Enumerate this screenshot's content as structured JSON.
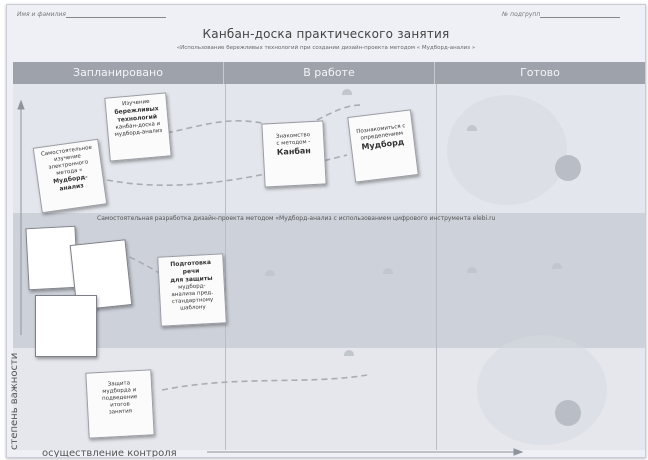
{
  "fields": {
    "name_label": "Имя и фамилия",
    "subgroup_label": "№ подгрупп"
  },
  "title": "Канбан-доска практического занятия",
  "subtitle": "«Использование бережливых технологий при создании дизайн-проекта методом « Мудборд-анализ »",
  "columns": [
    "Запланировано",
    "В работе",
    "Готово"
  ],
  "middle_band_text": "Самостоятельная разработка дизайн-проекта методом «Мудборд-анализ с использованием цифрового инструмента elebi.ru",
  "cards": {
    "study": {
      "l1": "Изучение",
      "l2": "бережливых",
      "l3": "технологий",
      "l4": "канбан-доска и",
      "l5": "мудборд-анализ"
    },
    "self": {
      "l1": "Самостоятельное",
      "l2": "изучение",
      "l3": "электронного",
      "l4": "метода «",
      "l5": "Мудборд-анализ"
    },
    "kanban": {
      "l1": "Знакомство",
      "l2": "с методом -",
      "l3": "Канбан"
    },
    "moodboard": {
      "l1": "Познакомиться с",
      "l2": "определением",
      "l3": "Мудборд"
    },
    "speech": {
      "l1": "Подготовка речи",
      "l2": "для защиты",
      "l3": "мудборд-",
      "l4": "анализа пред.",
      "l5": "стандартному",
      "l6": "шаблону"
    },
    "defense": {
      "l1": "Защита",
      "l2": "мудборда и",
      "l3": "подведение",
      "l4": "итогов",
      "l5": "занятия"
    }
  },
  "axes": {
    "y": "степень важности",
    "x": "осуществление контроля"
  }
}
